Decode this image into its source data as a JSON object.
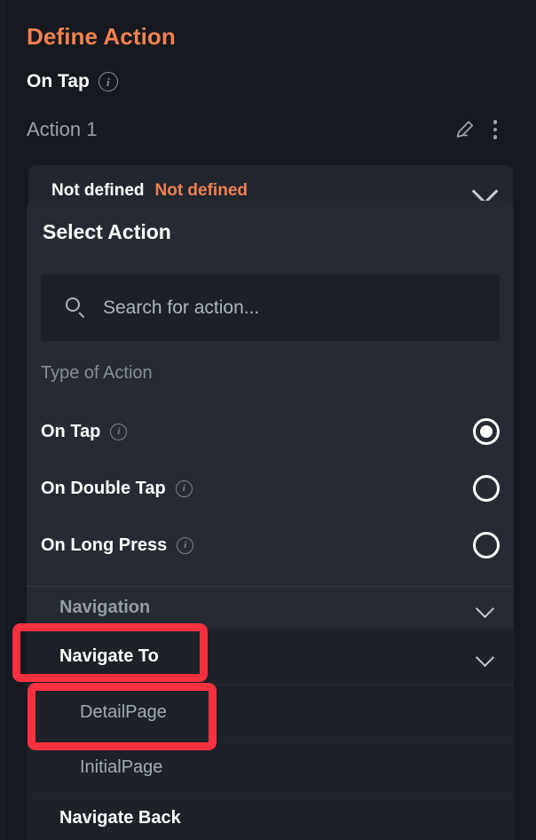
{
  "header": {
    "title": "Define Action",
    "trigger_label": "On Tap",
    "trigger_info_icon": "info-icon"
  },
  "action_item": {
    "name": "Action 1",
    "edit_icon": "pencil-icon",
    "more_icon": "kebab-menu-icon"
  },
  "action_field": {
    "primary": "Not defined",
    "secondary": "Not defined",
    "chevron_icon": "chevron-down-icon"
  },
  "dropdown": {
    "title": "Select Action",
    "search": {
      "icon": "search-icon",
      "placeholder": "Search for action...",
      "value": ""
    },
    "section_label": "Type of Action",
    "type_options": [
      {
        "label": "On Tap",
        "info_icon": "info-icon",
        "selected": true
      },
      {
        "label": "On Double Tap",
        "info_icon": "info-icon",
        "selected": false
      },
      {
        "label": "On Long Press",
        "info_icon": "info-icon",
        "selected": false
      }
    ],
    "groups": [
      {
        "label": "Navigation",
        "chevron_icon": "chevron-down-icon"
      },
      {
        "label": "Navigate To",
        "chevron_icon": "chevron-down-icon"
      }
    ],
    "pages": [
      {
        "label": "DetailPage"
      },
      {
        "label": "InitialPage"
      }
    ],
    "navigate_back": {
      "label": "Navigate Back"
    }
  },
  "annotations": {
    "color": "#f8313f",
    "boxes": [
      {
        "target": "Navigate To"
      },
      {
        "target": "DetailPage"
      }
    ]
  },
  "colors": {
    "accent_orange": "#f0814f",
    "page_background": "#16191f",
    "panel_background": "#262b33",
    "row_background": "#1d2229",
    "search_background": "#1c2127",
    "highlight_red": "#f8313f"
  }
}
